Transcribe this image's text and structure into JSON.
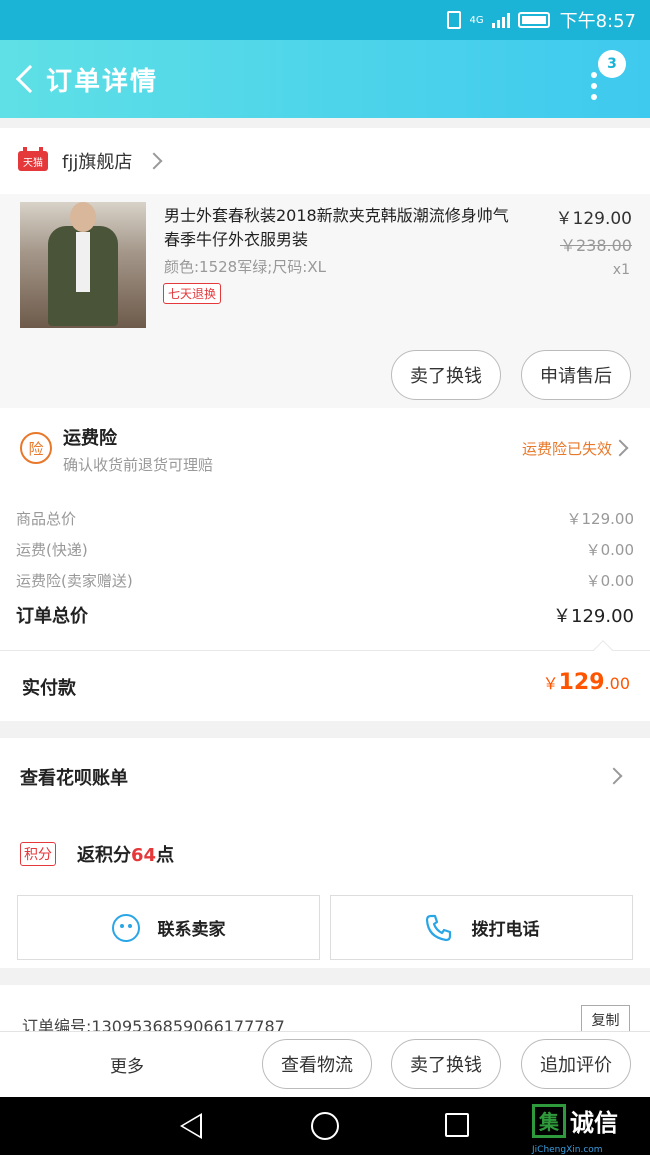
{
  "status_bar": {
    "network": "4G",
    "time": "下午8:57"
  },
  "header": {
    "title": "订单详情",
    "badge": "3"
  },
  "shop": {
    "name": "fjj旗舰店",
    "platform_logo": "天猫"
  },
  "product": {
    "title": "男士外套春秋装2018新款夹克韩版潮流修身帅气春季牛仔外衣服男装",
    "spec": "颜色:1528军绿;尺码:XL",
    "tag": "七天退换",
    "price": "￥129.00",
    "original_price": "￥238.00",
    "quantity": "x1",
    "actions": {
      "sell": "卖了换钱",
      "after_sale": "申请售后"
    }
  },
  "insurance": {
    "icon_text": "险",
    "title": "运费险",
    "desc": "确认收货前退货可理赔",
    "status": "运费险已失效"
  },
  "fees": [
    {
      "label": "商品总价",
      "value": "￥129.00"
    },
    {
      "label": "运费(快递)",
      "value": "￥0.00"
    },
    {
      "label": "运费险(卖家赠送)",
      "value": "￥0.00"
    }
  ],
  "order_total": {
    "label": "订单总价",
    "value": "￥129.00"
  },
  "paid": {
    "label": "实付款",
    "currency": "￥",
    "integer": "129",
    "decimal": ".00"
  },
  "huabei": {
    "label": "查看花呗账单"
  },
  "points": {
    "tag": "积分",
    "prefix": "返积分",
    "number": "64",
    "suffix": "点"
  },
  "contact": {
    "seller": "联系卖家",
    "phone": "拨打电话"
  },
  "order": {
    "number_label": "订单编号:",
    "number": "1309536859066177787",
    "copy": "复制"
  },
  "bottom_bar": {
    "more": "更多",
    "logistics": "查看物流",
    "sell": "卖了换钱",
    "review": "追加评价"
  },
  "watermark": {
    "box": "集",
    "text": "诚信",
    "sub": "JiChengXin.com"
  },
  "colors": {
    "accent": "#1bb4d6",
    "orange": "#ff5500",
    "red": "#e5383b",
    "insurance": "#e8782a"
  }
}
